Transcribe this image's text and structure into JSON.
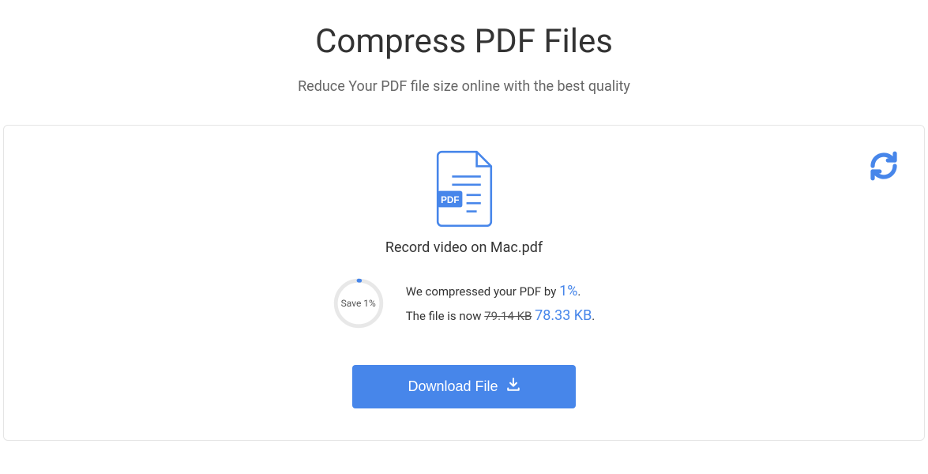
{
  "header": {
    "title": "Compress PDF Files",
    "subtitle": "Reduce Your PDF file size online with the best quality"
  },
  "result": {
    "filename": "Record video on Mac.pdf",
    "gauge_label": "Save 1%",
    "compress_prefix": "We compressed your PDF by ",
    "compress_percent": "1%",
    "filesize_prefix": "The file is now ",
    "old_size": "79.14 KB",
    "new_size": "78.33 KB",
    "download_label": "Download File"
  },
  "colors": {
    "accent": "#4786ea"
  }
}
